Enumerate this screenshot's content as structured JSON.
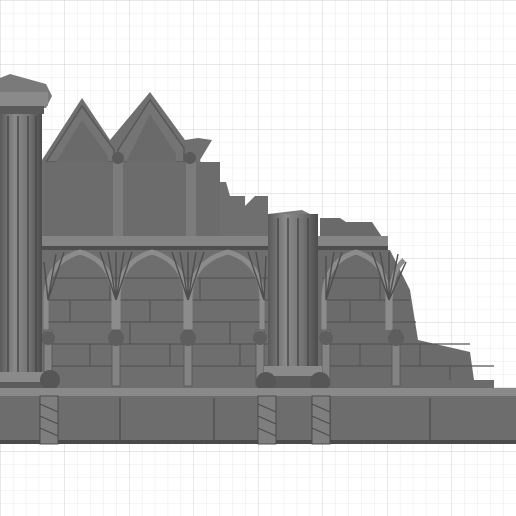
{
  "scene": {
    "subject": "gothic-ruined-wall-segment",
    "colors": {
      "background": "#ffffff",
      "grid_minor": "#e4e4e4",
      "grid_major": "#c8c8c8",
      "model_base": "#6e6e6e",
      "model_light": "#8a8a8a",
      "model_mid": "#777777",
      "model_dark": "#4a4a4a",
      "model_shadow": "#3c3c3c"
    }
  }
}
